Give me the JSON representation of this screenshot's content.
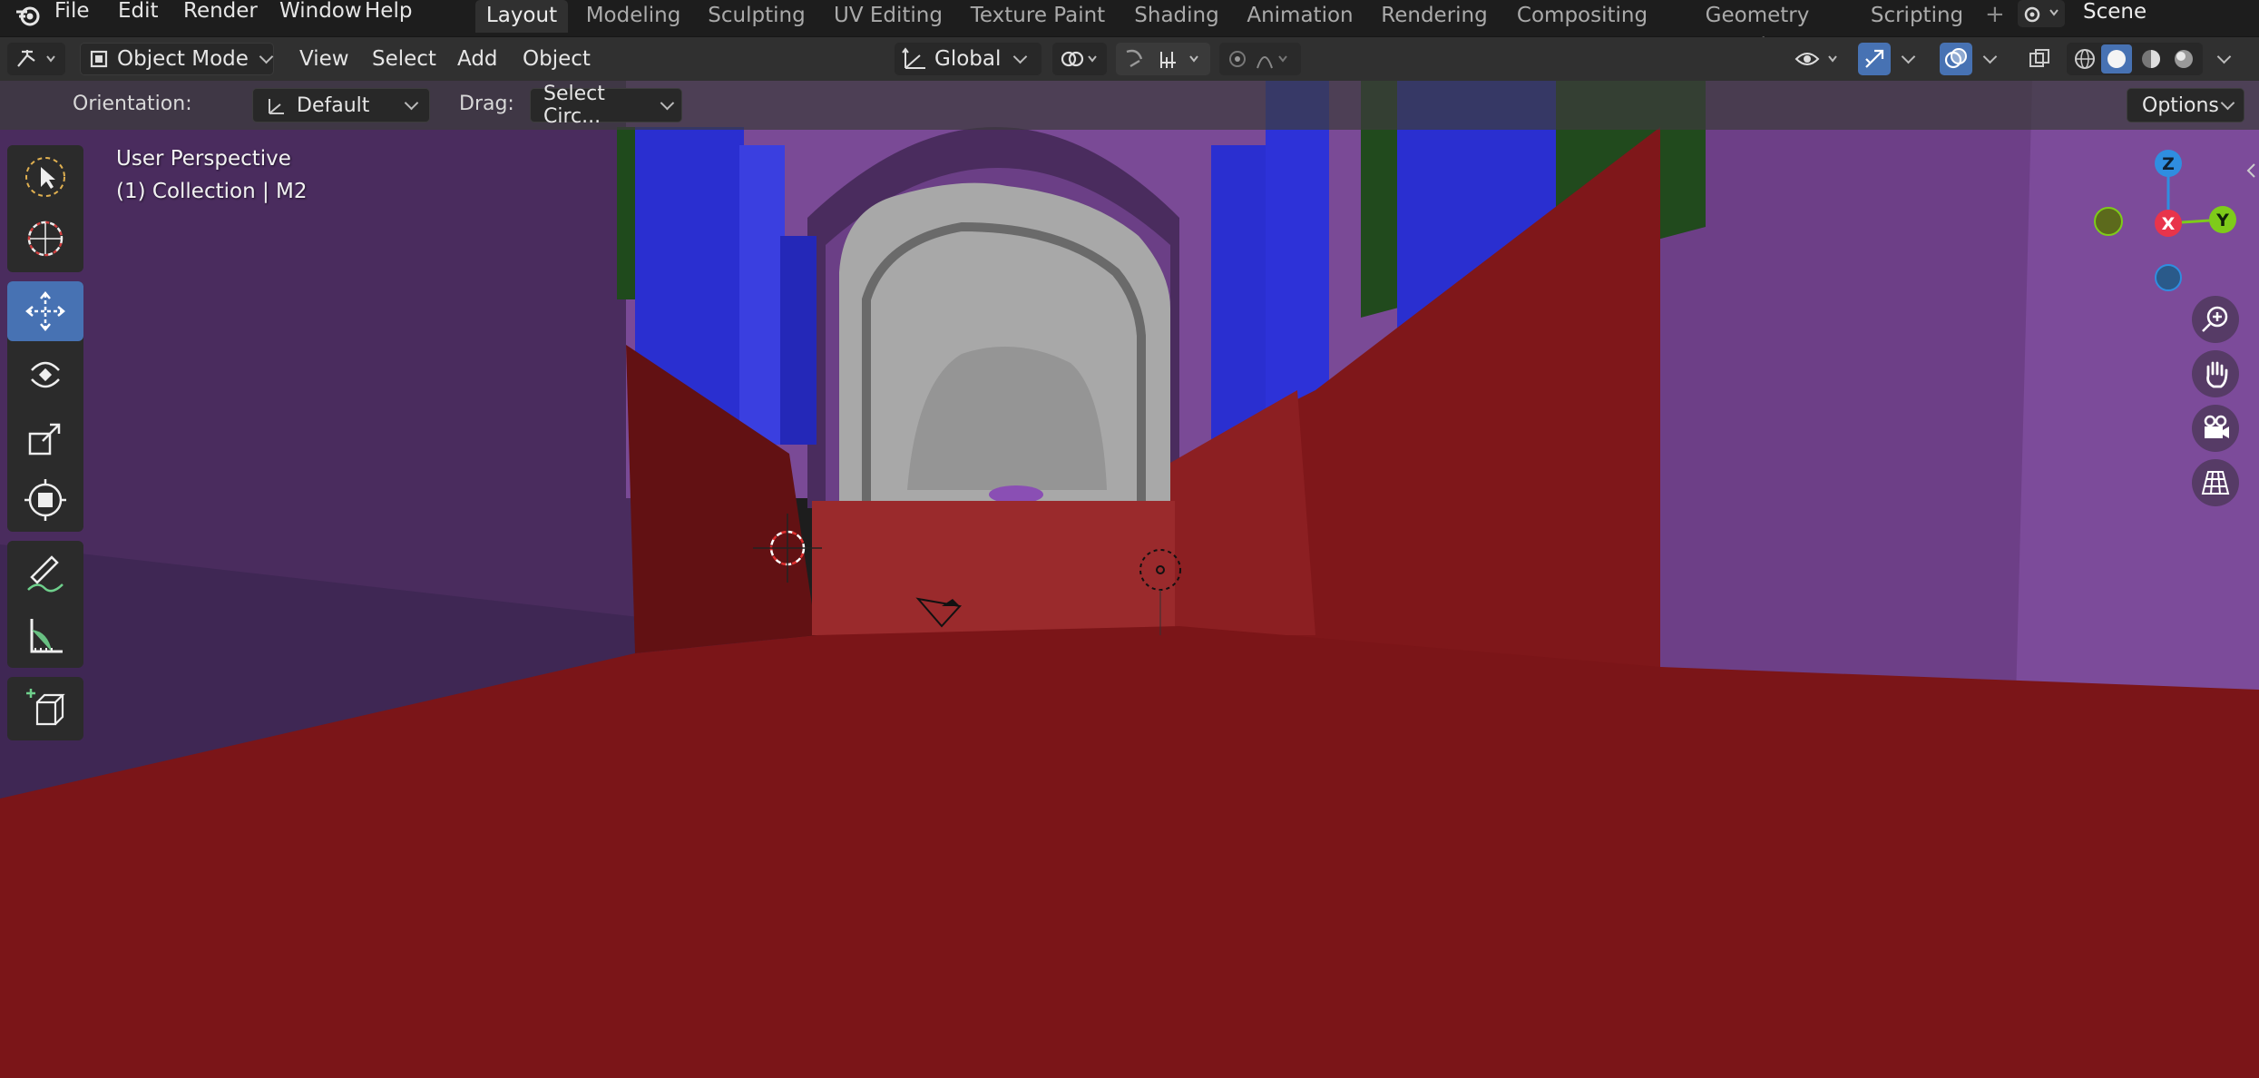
{
  "menubar": {
    "items": [
      "File",
      "Edit",
      "Render",
      "Window",
      "Help"
    ]
  },
  "workspaces": {
    "tabs": [
      "Layout",
      "Modeling",
      "Sculpting",
      "UV Editing",
      "Texture Paint",
      "Shading",
      "Animation",
      "Rendering",
      "Compositing",
      "Geometry Nodes",
      "Scripting"
    ],
    "active": "Layout",
    "add_glyph": "+"
  },
  "scene": {
    "name": "Scene"
  },
  "viewport_header": {
    "mode": "Object Mode",
    "menus": [
      "View",
      "Select",
      "Add",
      "Object"
    ],
    "orientation": "Global"
  },
  "tool_settings": {
    "orientation_label": "Orientation:",
    "orientation_value": "Default",
    "drag_label": "Drag:",
    "drag_value": "Select Circ...",
    "options_label": "Options"
  },
  "overlay": {
    "view_name": "User Perspective",
    "collection_info": "(1) Collection | M2"
  },
  "gizmo": {
    "z": "Z",
    "x": "X",
    "y": "Y"
  },
  "colors": {
    "accent": "#4772b3",
    "floor_red": "#7b1518",
    "purple_wall": "#6b3f86",
    "blue_pillar": "#2a2fd0",
    "axis_x": "#e8344b",
    "axis_y": "#7ecb1a",
    "axis_z": "#2f8ee0"
  }
}
